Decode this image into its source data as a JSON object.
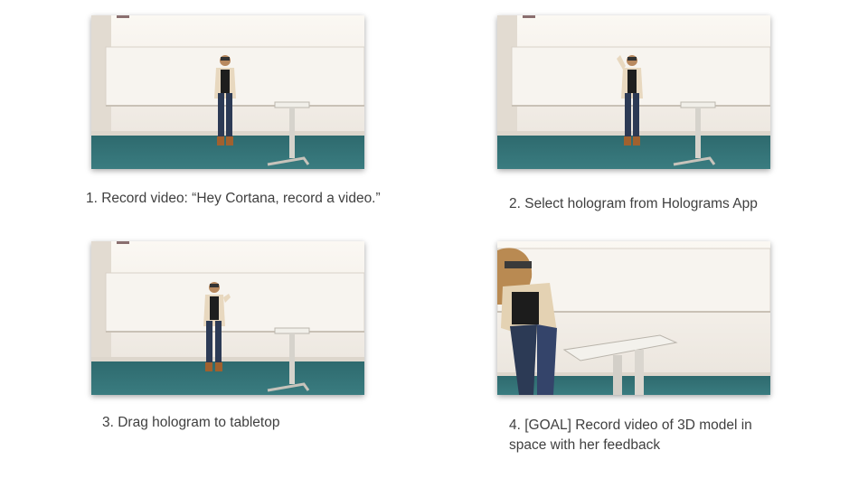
{
  "steps": [
    {
      "caption": "1. Record video: “Hey Cortana, record a video.”",
      "image": "woman-standing-in-room-photo"
    },
    {
      "caption": "2. Select hologram from Holograms App",
      "image": "woman-raising-hand-photo"
    },
    {
      "caption": "3. Drag hologram to tabletop",
      "image": "woman-gesturing-photo"
    },
    {
      "caption_line1": "4. [GOAL] Record video of 3D model in",
      "caption_line2": "space with her feedback",
      "image": "woman-closeup-with-table-photo"
    }
  ],
  "colors": {
    "wall": "#f0ebe4",
    "carpet": "#2f6f72",
    "text": "#3f3f3f"
  }
}
